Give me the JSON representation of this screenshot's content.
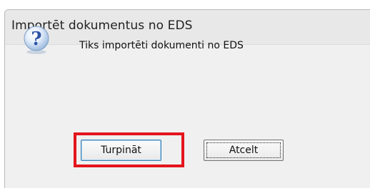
{
  "window": {
    "title": "Importēt dokumentus no EDS"
  },
  "dialog": {
    "icon": "question-icon",
    "message": "Tiks importēti dokumenti no EDS"
  },
  "buttons": {
    "continue_label": "Turpināt",
    "cancel_label": "Atcelt"
  },
  "colors": {
    "highlight": "#e4141b",
    "primary_border": "#3c7fb1",
    "icon_blue": "#2f6fc4"
  }
}
